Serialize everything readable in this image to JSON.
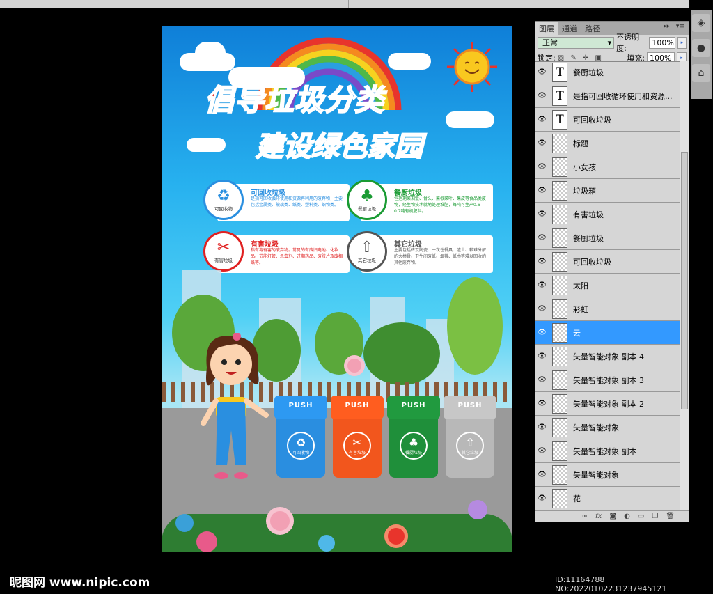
{
  "poster": {
    "title_line1_a": "倡导",
    "title_line1_b": "垃圾分类",
    "title_line2_a": "建设",
    "title_line2_b": "绿色家园",
    "cards": [
      {
        "title": "可回收垃圾",
        "badge": "可回收物",
        "desc": "是指可回收循环使用和资源再利用的废弃物，主要包括金属类、玻璃类、纸类、塑料类、织物类。",
        "color": "#2a8fe0"
      },
      {
        "title": "餐厨垃圾",
        "badge": "餐厨垃圾",
        "desc": "包括剩菜剩饭、骨头、菜根菜叶、果皮等食品类废物，经生物技术就地处理堆肥，每吨可生产0.6-0.7吨有机肥料。",
        "color": "#1a9b33"
      },
      {
        "title": "有害垃圾",
        "badge": "有害垃圾",
        "desc": "指有毒有害的废弃物。常见的有废旧电池、化妆品、节能灯管、杀虫剂、过期药品、废胶片及废相纸等。",
        "color": "#e02020"
      },
      {
        "title": "其它垃圾",
        "badge": "其它垃圾",
        "desc": "主要包括砖瓦陶瓷、一次性餐具、渣土、较难分解的大棒骨、卫生间废纸、烟蒂、纸巾等难以回收的其他废弃物。",
        "color": "#555555"
      }
    ],
    "bins": [
      {
        "lid": "PUSH",
        "label": "可回收物",
        "color": "#2a8ee0"
      },
      {
        "lid": "PUSH",
        "label": "有害垃圾",
        "color": "#f2561d"
      },
      {
        "lid": "PUSH",
        "label": "餐厨垃圾",
        "color": "#1f8f3a"
      },
      {
        "lid": "PUSH",
        "label": "其它垃圾",
        "color": "#b8b8b8"
      }
    ]
  },
  "panel": {
    "tabs": [
      "图层",
      "通道",
      "路径"
    ],
    "blend_mode": "正常",
    "opacity_label": "不透明度:",
    "opacity": "100%",
    "lock_label": "锁定:",
    "fill_label": "填充:",
    "fill": "100%",
    "layers": [
      {
        "name": "餐厨垃圾",
        "type": "text"
      },
      {
        "name": "是指可回收循环使用和资源...",
        "type": "text"
      },
      {
        "name": "可回收垃圾",
        "type": "text"
      },
      {
        "name": "标题",
        "type": "image"
      },
      {
        "name": "小女孩",
        "type": "image"
      },
      {
        "name": "垃圾箱",
        "type": "image"
      },
      {
        "name": "有害垃圾",
        "type": "image"
      },
      {
        "name": "餐厨垃圾",
        "type": "image"
      },
      {
        "name": "可回收垃圾",
        "type": "image"
      },
      {
        "name": "太阳",
        "type": "image"
      },
      {
        "name": "彩虹",
        "type": "image"
      },
      {
        "name": "云",
        "type": "image",
        "selected": true
      },
      {
        "name": "矢量智能对象 副本 4",
        "type": "image"
      },
      {
        "name": "矢量智能对象 副本 3",
        "type": "image"
      },
      {
        "name": "矢量智能对象 副本 2",
        "type": "image"
      },
      {
        "name": "矢量智能对象",
        "type": "image"
      },
      {
        "name": "矢量智能对象 副本",
        "type": "image"
      },
      {
        "name": "矢量智能对象",
        "type": "image"
      },
      {
        "name": "花",
        "type": "image"
      }
    ]
  },
  "watermark": "昵图网 www.nipic.com",
  "image_id": "ID:11164788 NO:20220102231237945121"
}
